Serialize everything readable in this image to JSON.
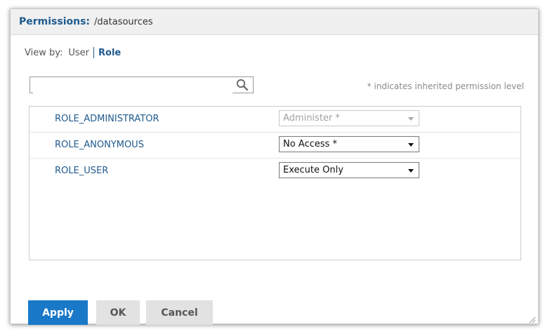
{
  "dialog": {
    "title_label": "Permissions:",
    "title_path": "/datasources"
  },
  "viewby": {
    "label": "View by:",
    "user": "User",
    "role": "Role"
  },
  "search": {
    "value": "",
    "placeholder": "",
    "icon": "search-icon"
  },
  "hint": "* indicates inherited permission level",
  "roles": [
    {
      "name": "ROLE_ADMINISTRATOR",
      "permission": "Administer *",
      "disabled": true
    },
    {
      "name": "ROLE_ANONYMOUS",
      "permission": "No Access *",
      "disabled": false
    },
    {
      "name": "ROLE_USER",
      "permission": "Execute Only",
      "disabled": false
    }
  ],
  "buttons": {
    "apply": "Apply",
    "ok": "OK",
    "cancel": "Cancel"
  },
  "colors": {
    "accent": "#205b8f",
    "apply_bg": "#1a78c8",
    "secondary_bg": "#e2e2e2"
  }
}
